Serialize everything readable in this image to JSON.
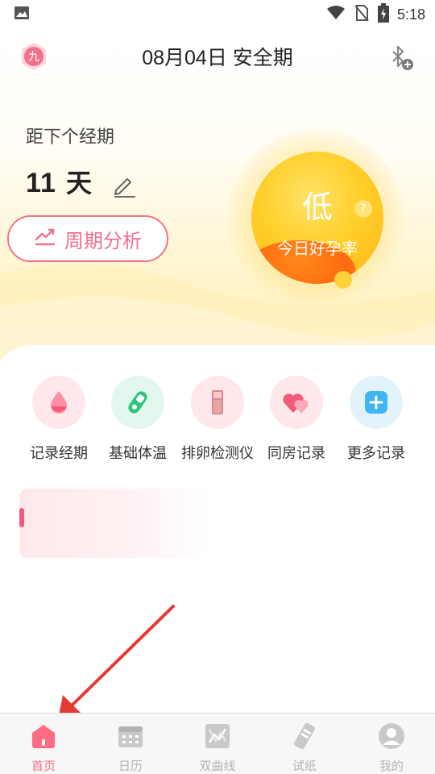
{
  "status_bar": {
    "time": "5:18",
    "icons": [
      "image-icon",
      "wifi-icon",
      "no-sim-icon",
      "battery-charging-icon"
    ]
  },
  "header": {
    "avatar_text": "九",
    "title": "08月04日 安全期",
    "bluetooth_icon": "bluetooth-add-icon"
  },
  "countdown": {
    "label": "距下个经期",
    "days": "11",
    "unit": "天"
  },
  "cycle_button": {
    "label": "周期分析"
  },
  "fertility": {
    "level": "低",
    "help": "?",
    "label": "今日好孕率"
  },
  "quick_records": [
    {
      "label": "记录经期",
      "icon": "blood-drop-icon",
      "bg": "#ffe8ec"
    },
    {
      "label": "基础体温",
      "icon": "thermometer-icon",
      "bg": "#e2f7ee"
    },
    {
      "label": "排卵检测仪",
      "icon": "ovulation-tester-icon",
      "bg": "#ffe8ec"
    },
    {
      "label": "同房记录",
      "icon": "hearts-icon",
      "bg": "#ffe8ec"
    },
    {
      "label": "更多记录",
      "icon": "plus-icon",
      "bg": "#e3f3fb"
    }
  ],
  "bottom_nav": [
    {
      "label": "首页",
      "icon": "home-icon",
      "active": true
    },
    {
      "label": "日历",
      "icon": "calendar-icon",
      "active": false
    },
    {
      "label": "双曲线",
      "icon": "chart-icon",
      "active": false
    },
    {
      "label": "试纸",
      "icon": "test-strip-icon",
      "active": false
    },
    {
      "label": "我的",
      "icon": "profile-icon",
      "active": false
    }
  ],
  "colors": {
    "accent": "#f2718a",
    "sun": "#ffcf2a",
    "nav_inactive": "#b5b5b5"
  }
}
